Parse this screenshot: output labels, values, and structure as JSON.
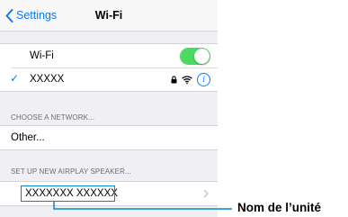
{
  "nav": {
    "back_label": "Settings",
    "title": "Wi-Fi"
  },
  "wifi_group": {
    "wifi_label": "Wi-Fi",
    "wifi_enabled": true,
    "connected_network": "XXXXX"
  },
  "choose_network": {
    "header": "CHOOSE A NETWORK...",
    "other_label": "Other..."
  },
  "airplay": {
    "header": "SET UP NEW AIRPLAY SPEAKER...",
    "speaker_name": "XXXXXXX  XXXXXX"
  },
  "callout": {
    "label": "Nom de l’unité"
  },
  "colors": {
    "accent": "#0a7aff",
    "toggle_on": "#4cd964",
    "highlight_box": "#0a87c9"
  },
  "icons": [
    "chevron-left-icon",
    "checkmark-icon",
    "lock-icon",
    "wifi-icon",
    "info-icon",
    "chevron-right-icon"
  ]
}
